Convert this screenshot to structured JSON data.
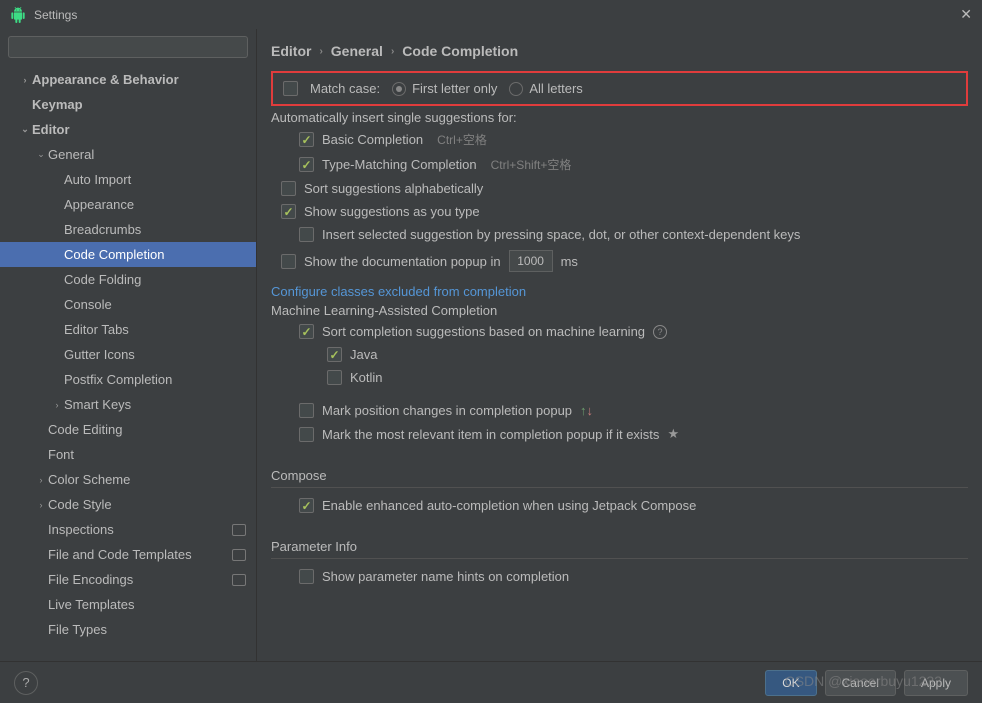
{
  "window": {
    "title": "Settings"
  },
  "search": {
    "placeholder": ""
  },
  "tree": [
    {
      "label": "Appearance & Behavior",
      "level": 0,
      "arrow": "›",
      "bold": true
    },
    {
      "label": "Keymap",
      "level": 0,
      "bold": true
    },
    {
      "label": "Editor",
      "level": 0,
      "arrow": "⌄",
      "bold": true
    },
    {
      "label": "General",
      "level": 1,
      "arrow": "⌄"
    },
    {
      "label": "Auto Import",
      "level": 2
    },
    {
      "label": "Appearance",
      "level": 2
    },
    {
      "label": "Breadcrumbs",
      "level": 2
    },
    {
      "label": "Code Completion",
      "level": 2,
      "selected": true
    },
    {
      "label": "Code Folding",
      "level": 2
    },
    {
      "label": "Console",
      "level": 2
    },
    {
      "label": "Editor Tabs",
      "level": 2
    },
    {
      "label": "Gutter Icons",
      "level": 2
    },
    {
      "label": "Postfix Completion",
      "level": 2
    },
    {
      "label": "Smart Keys",
      "level": 2,
      "arrow": "›"
    },
    {
      "label": "Code Editing",
      "level": 1
    },
    {
      "label": "Font",
      "level": 1
    },
    {
      "label": "Color Scheme",
      "level": 1,
      "arrow": "›"
    },
    {
      "label": "Code Style",
      "level": 1,
      "arrow": "›"
    },
    {
      "label": "Inspections",
      "level": 1,
      "badge": true
    },
    {
      "label": "File and Code Templates",
      "level": 1,
      "badge": true
    },
    {
      "label": "File Encodings",
      "level": 1,
      "badge": true
    },
    {
      "label": "Live Templates",
      "level": 1
    },
    {
      "label": "File Types",
      "level": 1
    }
  ],
  "breadcrumb": [
    "Editor",
    "General",
    "Code Completion"
  ],
  "opts": {
    "match_case": "Match case:",
    "first_letter": "First letter only",
    "all_letters": "All letters",
    "auto_insert_label": "Automatically insert single suggestions for:",
    "basic": "Basic Completion",
    "basic_sc": "Ctrl+空格",
    "type_match": "Type-Matching Completion",
    "type_match_sc": "Ctrl+Shift+空格",
    "sort_alpha": "Sort suggestions alphabetically",
    "show_as_type": "Show suggestions as you type",
    "insert_selected": "Insert selected suggestion by pressing space, dot, or other context-dependent keys",
    "show_doc_pre": "Show the documentation popup in",
    "show_doc_val": "1000",
    "show_doc_post": "ms",
    "configure_link": "Configure classes excluded from completion",
    "ml_heading": "Machine Learning-Assisted Completion",
    "ml_sort": "Sort completion suggestions based on machine learning",
    "java": "Java",
    "kotlin": "Kotlin",
    "mark_pos": "Mark position changes in completion popup",
    "mark_relevant": "Mark the most relevant item in completion popup if it exists",
    "compose_heading": "Compose",
    "compose_enable": "Enable enhanced auto-completion when using Jetpack Compose",
    "param_heading": "Parameter Info",
    "param_hints": "Show parameter name hints on completion"
  },
  "footer": {
    "ok": "OK",
    "cancel": "Cancel",
    "apply": "Apply"
  },
  "watermark": "CSDN @xiaoerbuyu1233"
}
